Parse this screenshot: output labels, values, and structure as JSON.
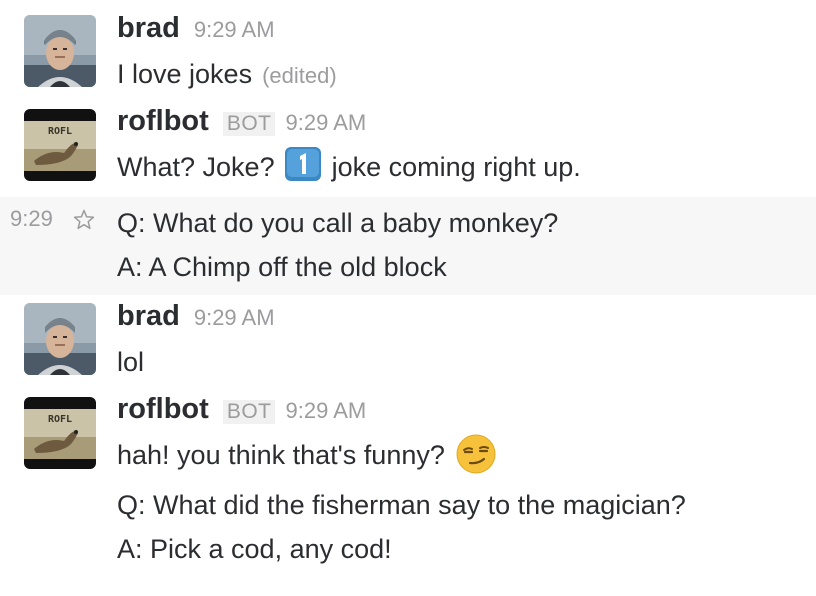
{
  "messages": [
    {
      "sender": "brad",
      "time": "9:29 AM",
      "lines": [
        "I love jokes"
      ],
      "edited_label": "(edited)"
    },
    {
      "sender": "roflbot",
      "badge": "BOT",
      "time": "9:29 AM",
      "line_before_icon": "What? Joke?",
      "line_after_icon": "joke coming right up.",
      "icon": "keycap-one-icon"
    },
    {
      "hover_time": "9:29",
      "lines": [
        "Q: What do you call a baby monkey?",
        "A: A Chimp off the old block"
      ]
    },
    {
      "sender": "brad",
      "time": "9:29 AM",
      "lines": [
        "lol"
      ]
    },
    {
      "sender": "roflbot",
      "badge": "BOT",
      "time": "9:29 AM",
      "line_before_icon": "hah! you think that's funny?",
      "icon": "smirk-face-icon",
      "lines": [
        "Q: What did the fisherman say to the magician?",
        "A: Pick a cod, any cod!"
      ]
    }
  ],
  "avatar_roflbot_text": "ROFL",
  "colors": {
    "text": "#2c2d30",
    "meta": "#9c9c9f",
    "hover_bg": "#f7f7f7",
    "keycap_blue": "#3b88c3"
  }
}
